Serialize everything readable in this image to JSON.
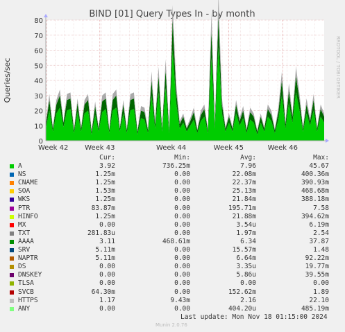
{
  "chart_data": {
    "type": "area",
    "title": "BIND [01] Query Types In - by month",
    "ylabel": "Queries/sec",
    "ylim": [
      0,
      80
    ],
    "yticks": [
      0,
      10,
      20,
      30,
      40,
      50,
      60,
      70,
      80
    ],
    "xticks": [
      "Week 42",
      "Week 43",
      "Week 44",
      "Week 45",
      "Week 46"
    ],
    "grid": true,
    "watermark": "RRDTOOL / TOBI OETIKER",
    "series": [
      {
        "name": "A",
        "color": "#00cc00",
        "values": [
          8,
          20,
          6,
          18,
          22,
          9,
          20,
          21,
          5,
          19,
          6,
          18,
          20,
          4,
          17,
          6,
          19,
          21,
          5,
          20,
          22,
          6,
          18,
          5,
          20,
          21,
          4,
          15,
          14,
          5,
          30,
          8,
          32,
          6,
          35,
          5,
          60,
          25,
          8,
          12,
          6,
          10,
          14,
          5,
          13,
          16,
          5,
          55,
          8,
          62,
          18,
          6,
          12,
          6,
          18,
          10,
          15,
          5,
          14,
          12,
          4,
          12,
          6,
          16,
          13,
          5,
          14,
          30,
          8,
          25,
          12,
          32,
          20,
          6,
          18,
          10,
          20,
          6,
          16,
          12
        ]
      },
      {
        "name": "AAAA",
        "color": "#006600",
        "values": [
          3,
          7,
          2,
          6,
          8,
          3,
          7,
          7,
          2,
          6,
          2,
          6,
          7,
          2,
          6,
          2,
          7,
          7,
          2,
          7,
          8,
          2,
          6,
          2,
          7,
          7,
          2,
          5,
          5,
          2,
          10,
          3,
          11,
          2,
          12,
          2,
          20,
          8,
          3,
          4,
          2,
          3,
          5,
          2,
          4,
          5,
          2,
          18,
          3,
          20,
          6,
          2,
          4,
          2,
          6,
          3,
          5,
          2,
          5,
          4,
          2,
          4,
          2,
          5,
          4,
          2,
          5,
          10,
          3,
          8,
          4,
          11,
          7,
          2,
          6,
          3,
          7,
          2,
          5,
          4
        ]
      },
      {
        "name": "HTTPS",
        "color": "#aaaaaa",
        "values": [
          1,
          4,
          1,
          3,
          4,
          1,
          4,
          4,
          1,
          3,
          1,
          3,
          4,
          1,
          3,
          1,
          4,
          4,
          1,
          4,
          4,
          1,
          3,
          1,
          4,
          4,
          1,
          3,
          3,
          1,
          6,
          2,
          6,
          1,
          7,
          1,
          10,
          5,
          2,
          2,
          1,
          2,
          3,
          1,
          3,
          3,
          1,
          12,
          2,
          15,
          4,
          1,
          2,
          1,
          3,
          2,
          3,
          1,
          3,
          2,
          1,
          2,
          1,
          3,
          3,
          1,
          3,
          6,
          2,
          5,
          2,
          6,
          4,
          1,
          4,
          2,
          4,
          1,
          3,
          2
        ]
      }
    ]
  },
  "legend": {
    "headers": {
      "cur": "Cur:",
      "min": "Min:",
      "avg": "Avg:",
      "max": "Max:"
    },
    "rows": [
      {
        "name": "A",
        "color": "#00cc00",
        "cur": "3.92",
        "min": "736.25m",
        "avg": "7.96",
        "max": "45.67"
      },
      {
        "name": "NS",
        "color": "#0066b3",
        "cur": "1.25m",
        "min": "0.00",
        "avg": "22.08m",
        "max": "400.36m"
      },
      {
        "name": "CNAME",
        "color": "#ff8000",
        "cur": "1.25m",
        "min": "0.00",
        "avg": "22.37m",
        "max": "390.93m"
      },
      {
        "name": "SOA",
        "color": "#ffcc00",
        "cur": "1.53m",
        "min": "0.00",
        "avg": "25.13m",
        "max": "468.68m"
      },
      {
        "name": "WKS",
        "color": "#330099",
        "cur": "1.25m",
        "min": "0.00",
        "avg": "21.84m",
        "max": "388.18m"
      },
      {
        "name": "PTR",
        "color": "#990099",
        "cur": "83.87m",
        "min": "0.00",
        "avg": "195.71m",
        "max": "7.58"
      },
      {
        "name": "HINFO",
        "color": "#ccff00",
        "cur": "1.25m",
        "min": "0.00",
        "avg": "21.88m",
        "max": "394.62m"
      },
      {
        "name": "MX",
        "color": "#ff0000",
        "cur": "0.00",
        "min": "0.00",
        "avg": "3.54u",
        "max": "6.19m"
      },
      {
        "name": "TXT",
        "color": "#808080",
        "cur": "281.83u",
        "min": "0.00",
        "avg": "1.97m",
        "max": "2.54"
      },
      {
        "name": "AAAA",
        "color": "#008f00",
        "cur": "3.11",
        "min": "468.61m",
        "avg": "6.34",
        "max": "37.87"
      },
      {
        "name": "SRV",
        "color": "#00487d",
        "cur": "5.11m",
        "min": "0.00",
        "avg": "15.57m",
        "max": "1.48"
      },
      {
        "name": "NAPTR",
        "color": "#b35a00",
        "cur": "5.11m",
        "min": "0.00",
        "avg": "6.64m",
        "max": "92.22m"
      },
      {
        "name": "DS",
        "color": "#b38f00",
        "cur": "0.00",
        "min": "0.00",
        "avg": "3.35u",
        "max": "19.77m"
      },
      {
        "name": "DNSKEY",
        "color": "#6b006b",
        "cur": "0.00",
        "min": "0.00",
        "avg": "5.86u",
        "max": "39.55m"
      },
      {
        "name": "TLSA",
        "color": "#8fb300",
        "cur": "0.00",
        "min": "0.00",
        "avg": "0.00",
        "max": "0.00"
      },
      {
        "name": "SVCB",
        "color": "#b30000",
        "cur": "64.30m",
        "min": "0.00",
        "avg": "152.62m",
        "max": "1.89"
      },
      {
        "name": "HTTPS",
        "color": "#bebebe",
        "cur": "1.17",
        "min": "9.43m",
        "avg": "2.16",
        "max": "22.10"
      },
      {
        "name": "ANY",
        "color": "#80ff80",
        "cur": "0.00",
        "min": "0.00",
        "avg": "404.20u",
        "max": "485.19m"
      }
    ]
  },
  "footer": {
    "last_update": "Last update: Mon Nov 18 01:15:00 2024",
    "generator": "Munin 2.0.76"
  }
}
